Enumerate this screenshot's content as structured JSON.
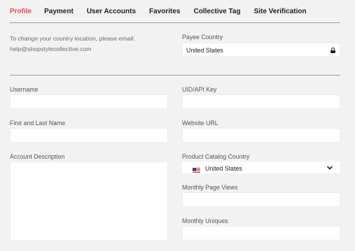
{
  "tabs": [
    {
      "label": "Profile",
      "active": true
    },
    {
      "label": "Payment",
      "active": false
    },
    {
      "label": "User Accounts",
      "active": false
    },
    {
      "label": "Favorites",
      "active": false
    },
    {
      "label": "Collective Tag",
      "active": false
    },
    {
      "label": "Site Verification",
      "active": false
    }
  ],
  "note": {
    "line1": "To change your country location, please email:",
    "line2": "help@shopstylecollective.com"
  },
  "payee_country": {
    "label": "Payee Country",
    "value": "United States",
    "icon": "lock-icon"
  },
  "username": {
    "label": "Username",
    "value": ""
  },
  "uid_api_key": {
    "label": "UID/API Key",
    "value": ""
  },
  "first_last_name": {
    "label": "First and Last Name",
    "value": ""
  },
  "website_url": {
    "label": "Website URL",
    "value": ""
  },
  "account_description": {
    "label": "Account Description",
    "value": ""
  },
  "product_catalog_country": {
    "label": "Product Catalog Country",
    "value": "United States",
    "icon": "us-flag-icon"
  },
  "monthly_page_views": {
    "label": "Monthly Page Views",
    "value": ""
  },
  "monthly_uniques": {
    "label": "Monthly Uniques",
    "value": ""
  },
  "colors": {
    "accent": "#d9534f",
    "background": "#f2f2f2",
    "field": "#ffffff",
    "divider": "#9a9a9a"
  }
}
